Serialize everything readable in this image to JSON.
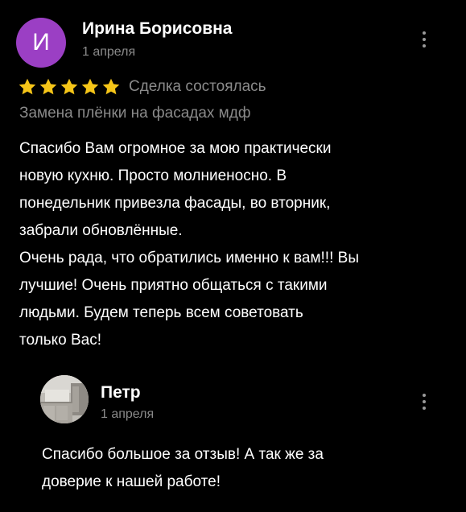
{
  "review": {
    "avatar_letter": "И",
    "avatar_color": "#9b3fc4",
    "author": "Ирина Борисовна",
    "date": "1 апреля",
    "rating": 5,
    "rating_max": 5,
    "star_color": "#f5c518",
    "deal_status": "Сделка состоялась",
    "service": "Замена плёнки на фасадах мдф",
    "paragraph1": [
      "Спасибо Вам огромное за мою практически",
      "новую кухню. Просто молниеносно. В",
      "понедельник привезла фасады, во вторник,",
      "забрали обновлённые."
    ],
    "paragraph2": [
      "Очень рада, что обратились именно к вам!!! Вы",
      "лучшие! Очень приятно общаться с такими",
      "людьми. Будем теперь всем советовать",
      "только Вас!"
    ]
  },
  "reply": {
    "author": "Петр",
    "date": "1 апреля",
    "text": [
      "Спасибо большое за отзыв! А так же за",
      "доверие к нашей работе!"
    ]
  }
}
